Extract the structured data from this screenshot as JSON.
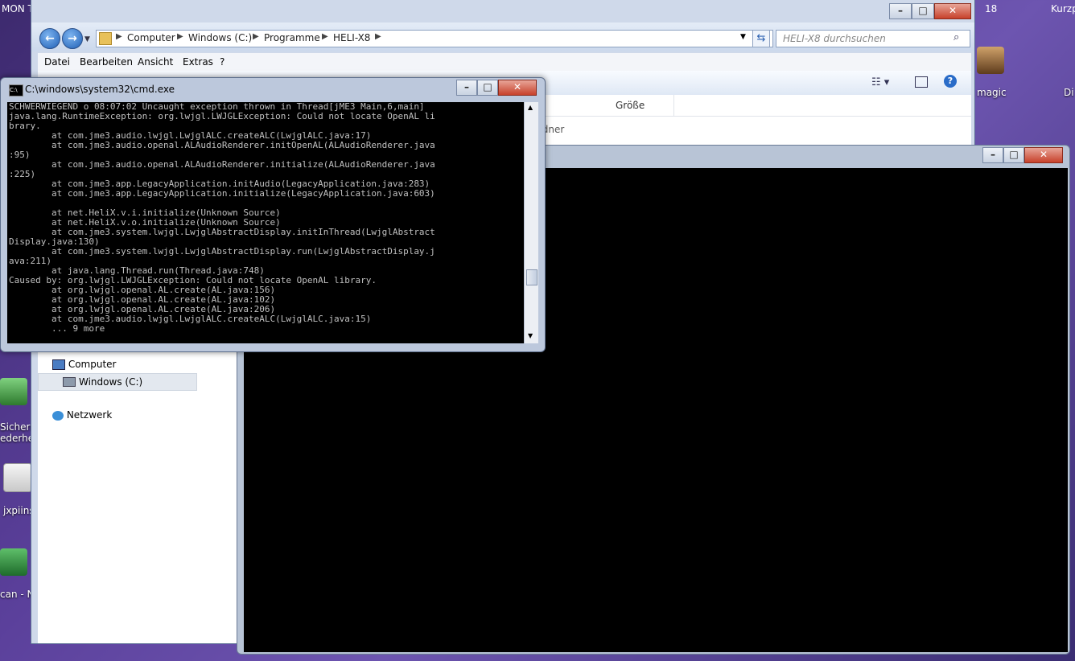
{
  "desktop": {
    "top_texts": [
      "MON T",
      "18",
      "Kurzp"
    ],
    "icons": [
      {
        "label": "magic"
      },
      {
        "label": "Di"
      },
      {
        "label": "Sichern"
      },
      {
        "label": "ederhe"
      },
      {
        "label": "jxpiins"
      },
      {
        "label": "can - N"
      }
    ]
  },
  "explorer": {
    "breadcrumb": [
      "Computer",
      "Windows (C:)",
      "Programme",
      "HELI-X8"
    ],
    "search_placeholder": "HELI-X8 durchsuchen",
    "menu": [
      "Datei",
      "Bearbeiten",
      "Ansicht",
      "Extras",
      "?"
    ],
    "column_header": "Größe",
    "folder_hint": "rdner",
    "nav_items": [
      "Computer",
      "Windows (C:)",
      "Netzwerk"
    ]
  },
  "cmd": {
    "title": "C:\\windows\\system32\\cmd.exe",
    "lines": [
      "SCHWERWIEGEND o 08:07:02 Uncaught exception thrown in Thread[jME3 Main,6,main]",
      "java.lang.RuntimeException: org.lwjgl.LWJGLException: Could not locate OpenAL li",
      "brary.",
      "        at com.jme3.audio.lwjgl.LwjglALC.createALC(LwjglALC.java:17)",
      "        at com.jme3.audio.openal.ALAudioRenderer.initOpenAL(ALAudioRenderer.java",
      ":95)",
      "        at com.jme3.audio.openal.ALAudioRenderer.initialize(ALAudioRenderer.java",
      ":225)",
      "        at com.jme3.app.LegacyApplication.initAudio(LegacyApplication.java:283)",
      "        at com.jme3.app.LegacyApplication.initialize(LegacyApplication.java:603)",
      "",
      "        at net.HeliX.v.i.initialize(Unknown Source)",
      "        at net.HeliX.v.o.initialize(Unknown Source)",
      "        at com.jme3.system.lwjgl.LwjglAbstractDisplay.initInThread(LwjglAbstract",
      "Display.java:130)",
      "        at com.jme3.system.lwjgl.LwjglAbstractDisplay.run(LwjglAbstractDisplay.j",
      "ava:211)",
      "        at java.lang.Thread.run(Thread.java:748)",
      "Caused by: org.lwjgl.LWJGLException: Could not locate OpenAL library.",
      "        at org.lwjgl.openal.AL.create(AL.java:156)",
      "        at org.lwjgl.openal.AL.create(AL.java:102)",
      "        at org.lwjgl.openal.AL.create(AL.java:206)",
      "        at com.jme3.audio.lwjgl.LwjglALC.createALC(LwjglALC.java:15)",
      "        ... 9 more"
    ]
  },
  "colors": {
    "console_bg": "#000000",
    "console_fg": "#c0c0c0",
    "close_red": "#c7412b"
  }
}
